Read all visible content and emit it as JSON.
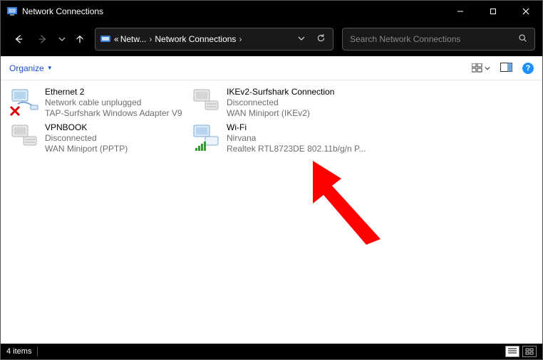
{
  "titlebar": {
    "title": "Network Connections"
  },
  "breadcrumb": {
    "prefix": "«",
    "seg1": "Netw...",
    "seg2": "Network Connections"
  },
  "search": {
    "placeholder": "Search Network Connections"
  },
  "toolbar": {
    "organize": "Organize"
  },
  "connections": [
    {
      "name": "Ethernet 2",
      "line2": "Network cable unplugged",
      "line3": "TAP-Surfshark Windows Adapter V9",
      "state": "error"
    },
    {
      "name": "IKEv2-Surfshark Connection",
      "line2": "Disconnected",
      "line3": "WAN Miniport (IKEv2)",
      "state": "disconnected"
    },
    {
      "name": "VPNBOOK",
      "line2": "Disconnected",
      "line3": "WAN Miniport (PPTP)",
      "state": "disconnected"
    },
    {
      "name": "Wi-Fi",
      "line2": "Nirvana",
      "line3": "Realtek RTL8723DE 802.11b/g/n P...",
      "state": "wifi"
    }
  ],
  "statusbar": {
    "count": "4 items"
  }
}
